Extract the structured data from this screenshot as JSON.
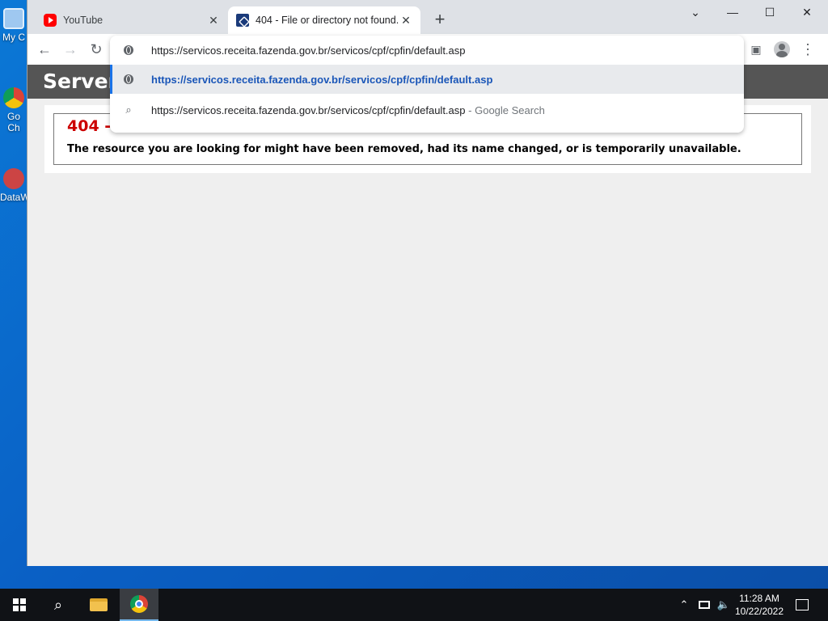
{
  "desktop": {
    "icons": [
      {
        "label": "My C"
      },
      {
        "label": "Go Ch"
      },
      {
        "label": "DataW"
      }
    ]
  },
  "browser": {
    "tabs": [
      {
        "title": "YouTube",
        "icon": "youtube-icon"
      },
      {
        "title": "404 - File or directory not found.",
        "icon": "receita-federal-icon"
      }
    ],
    "new_tab_label": "+",
    "omnibox": {
      "input_value": "https://servicos.receita.fazenda.gov.br/servicos/cpf/cpfin/default.asp",
      "suggestions": [
        {
          "text": "https://servicos.receita.fazenda.gov.br/servicos/cpf/cpfin/default.asp",
          "icon": "globe-icon"
        },
        {
          "text": "https://servicos.receita.fazenda.gov.br/servicos/cpf/cpfin/default.asp",
          "suffix": "Google Search",
          "separator": "-",
          "icon": "search-icon"
        }
      ]
    }
  },
  "page": {
    "header": "Server",
    "error_title": "404 -",
    "error_message": "The resource you are looking for might have been removed, had its name changed, or is temporarily unavailable."
  },
  "taskbar": {
    "time": "11:28 AM",
    "date": "10/22/2022"
  },
  "colors": {
    "error_red": "#cc0000",
    "header_gray": "#555555",
    "suggestion_blue": "#1a56b8",
    "desktop_blue": "#0b78d6"
  }
}
